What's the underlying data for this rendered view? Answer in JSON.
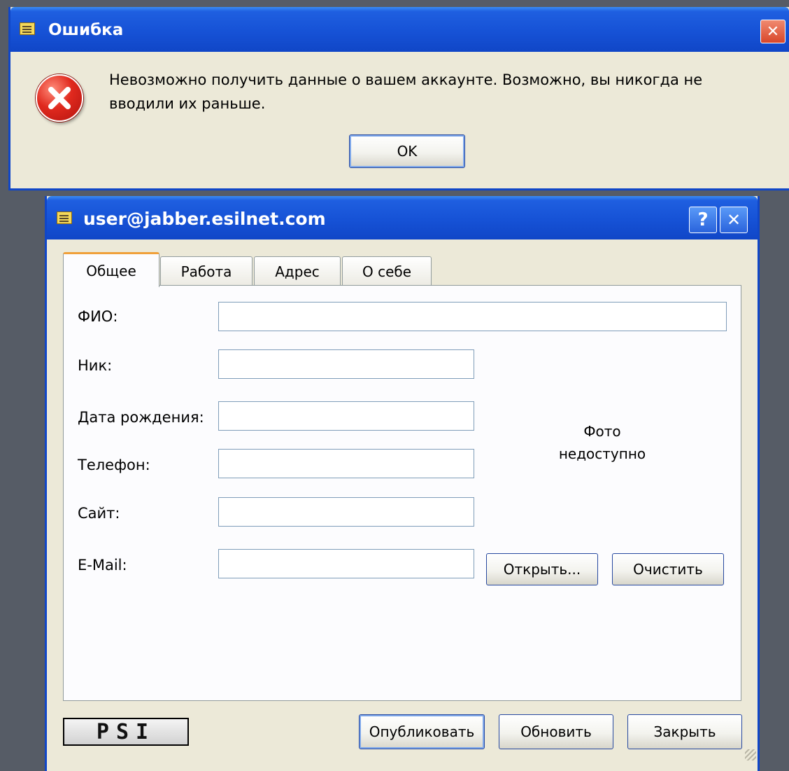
{
  "error_dialog": {
    "title": "Ошибка",
    "message_line1": "Невозможно получить данные о вашем аккаунте. Возможно, вы никогда не",
    "message_line2": "вводили их раньше.",
    "ok_label": "OK",
    "close_glyph": "✕"
  },
  "vcard_dialog": {
    "title": "user@jabber.esilnet.com",
    "help_glyph": "?",
    "close_glyph": "✕",
    "tabs": [
      {
        "label": "Общее",
        "active": true
      },
      {
        "label": "Работа",
        "active": false
      },
      {
        "label": "Адрес",
        "active": false
      },
      {
        "label": "О себе",
        "active": false
      }
    ],
    "fields": {
      "fullname": {
        "label": "ФИО:",
        "value": ""
      },
      "nick": {
        "label": "Ник:",
        "value": ""
      },
      "birthday": {
        "label": "Дата рождения:",
        "value": ""
      },
      "phone": {
        "label": "Телефон:",
        "value": ""
      },
      "site": {
        "label": "Сайт:",
        "value": ""
      },
      "email": {
        "label": "E-Mail:",
        "value": ""
      }
    },
    "photo_line1": "Фото",
    "photo_line2": "недоступно",
    "open_label": "Открыть...",
    "clear_label": "Очистить",
    "logo_text": "PSI",
    "publish_label": "Опубликовать",
    "refresh_label": "Обновить",
    "close_label": "Закрыть"
  },
  "colors": {
    "titlebar": "#1652d6",
    "dialog_face": "#ece9d8",
    "close_button": "#e0543a",
    "error_icon": "#d8221a"
  }
}
